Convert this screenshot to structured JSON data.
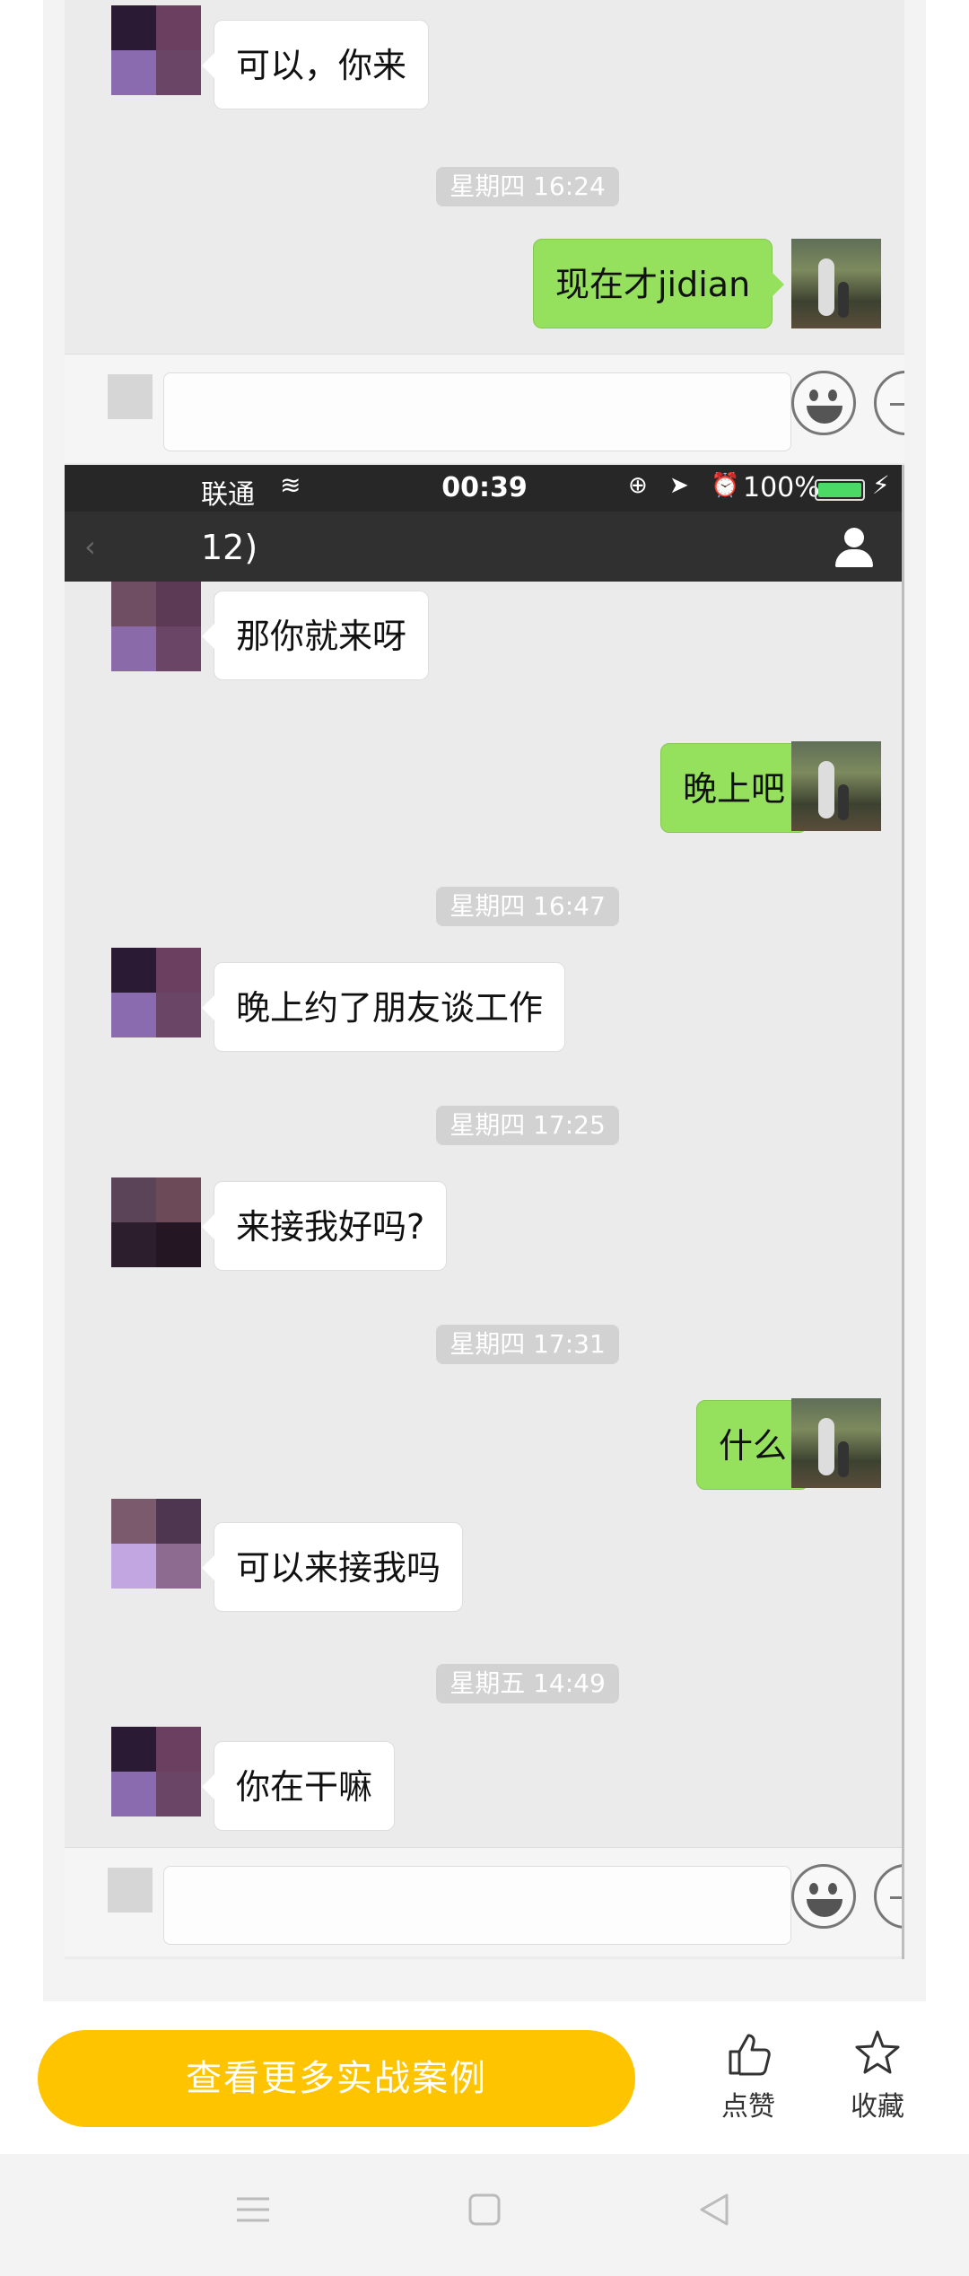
{
  "conversation_top": {
    "msg_1": "可以，你来",
    "time_1": "星期四 16:24",
    "msg_2": "现在才jidian"
  },
  "status_bar": {
    "carrier": "联通",
    "time": "00:39",
    "battery": "100%",
    "icons": "⊕ ➤ ⏰"
  },
  "nav": {
    "title": "12)",
    "back": "‹"
  },
  "conversation_bottom": {
    "msg_3": "那你就来呀",
    "msg_4": "晚上吧",
    "time_2": "星期四 16:47",
    "msg_5": "晚上约了朋友谈工作",
    "time_3": "星期四 17:25",
    "msg_6": "来接我好吗?",
    "time_4": "星期四 17:31",
    "msg_7": "什么",
    "msg_8": "可以来接我吗",
    "time_5": "星期五 14:49",
    "msg_9": "你在干嘛"
  },
  "bottom_bar": {
    "cta_label": "查看更多实战案例",
    "like_label": "点赞",
    "favorite_label": "收藏"
  },
  "colors": {
    "cta": "#ffc400",
    "my_bubble": "#95e05c",
    "their_bubble": "#ffffff"
  },
  "icons": [
    "emoji-icon",
    "plus-icon",
    "person-icon",
    "thumbs-up-icon",
    "star-icon",
    "menu-icon",
    "home-icon",
    "back-icon"
  ]
}
